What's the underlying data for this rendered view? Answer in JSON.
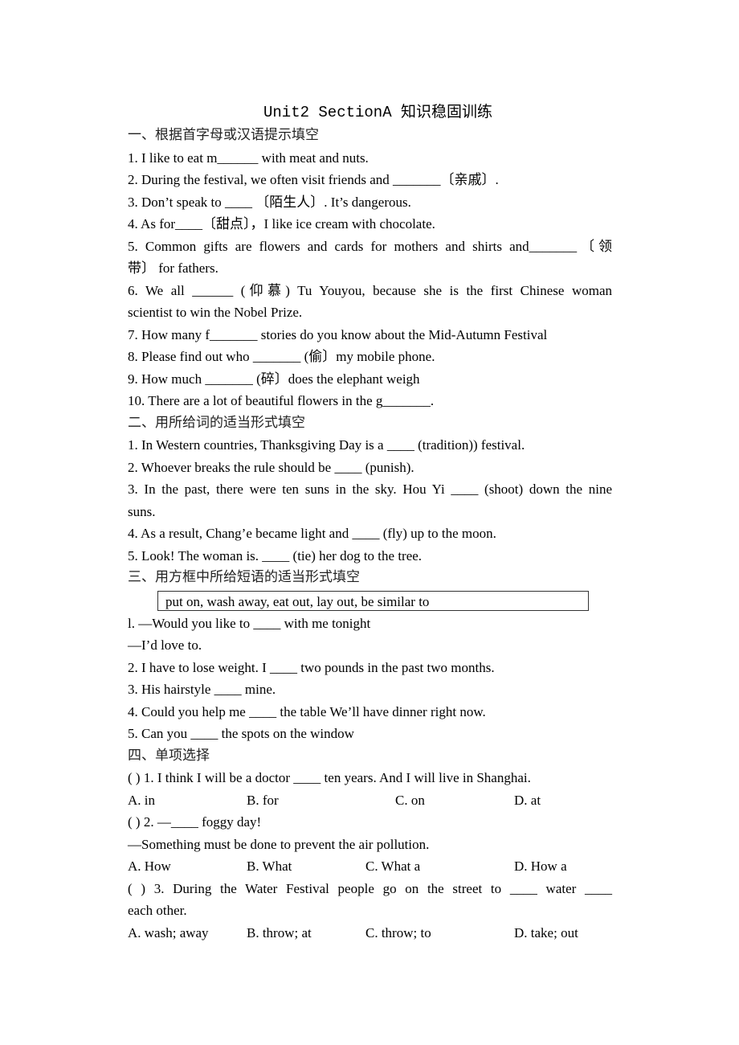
{
  "title": "Unit2 SectionA 知识稳固训练",
  "section1": {
    "heading": "一、根据首字母或汉语提示填空",
    "items": [
      "1. I like to eat m______ with meat and nuts.",
      "2. During the festival, we often visit friends and _______〔亲戚〕.",
      "3. Don’t speak to ____ 〔陌生人〕. It’s dangerous.",
      "4. As for____〔甜点〕，I like ice cream with chocolate.",
      "5. Common gifts are flowers and cards for mothers and shirts and_______〔领带〕 for fathers.",
      "6. We all ______ (仰慕) Tu Youyou, because she is the first Chinese woman scientist to win the Nobel Prize.",
      "7. How many f_______ stories do you know about the Mid-Autumn Festival",
      "8. Please find out who _______ (偷〕my mobile phone.",
      "9. How much _______ (碎〕does the elephant weigh",
      "10. There are a lot of beautiful flowers in the g_______."
    ],
    "item5_line1": "5. Common gifts are flowers and cards for mothers and shirts and_______〔领",
    "item5_line2": "带〕 for fathers.",
    "item6_line1": "6. We all ______ (仰慕) Tu Youyou, because she is the first Chinese woman",
    "item6_line2": "scientist to win the Nobel Prize."
  },
  "section2": {
    "heading": "二、用所给词的适当形式填空",
    "items": [
      "1. In Western countries, Thanksgiving Day is a ____ (tradition)) festival.",
      "2. Whoever breaks the rule should be ____ (punish).",
      "3. In the past, there were ten suns in the sky. Hou Yi ____ (shoot) down the nine suns.",
      "4. As a result, Chang’e became light and ____ (fly) up to the moon.",
      "5. Look! The woman is. ____ (tie) her dog to the tree."
    ],
    "item3_line1": "3. In the past, there were ten suns in the sky. Hou Yi ____ (shoot) down the nine",
    "item3_line2": "suns."
  },
  "section3": {
    "heading": "三、用方框中所给短语的适当形式填空",
    "phrase_box": "put on, wash away, eat out, lay out, be similar to",
    "items": [
      "l. —Would you like to ____ with me tonight",
      "—I’d love to.",
      "2. I have to lose weight. I ____ two pounds in the past two months.",
      "3. His hairstyle ____ mine.",
      "4. Could you help me ____ the table We’ll have dinner right now.",
      "5. Can you ____ the spots on the window"
    ]
  },
  "section4": {
    "heading": "四、单项选择",
    "questions": [
      {
        "stem": "(        ) 1. I think I will be a doctor ____ ten years. And I will live in Shanghai.",
        "options": [
          "A. in",
          "B. for",
          "C. on",
          "D. at"
        ]
      },
      {
        "stem": "(        ) 2. —____ foggy day!",
        "stem2": "—Something must be done to prevent the air pollution.",
        "options": [
          "A. How",
          "B. What",
          "C. What a",
          "D. How a"
        ]
      },
      {
        "stem": "(        ) 3. During the Water Festival people go on the street to ____ water ____",
        "stem2": "each other.",
        "options": [
          "A. wash; away",
          "B. throw; at",
          "C. throw; to",
          "D. take; out"
        ]
      }
    ]
  }
}
